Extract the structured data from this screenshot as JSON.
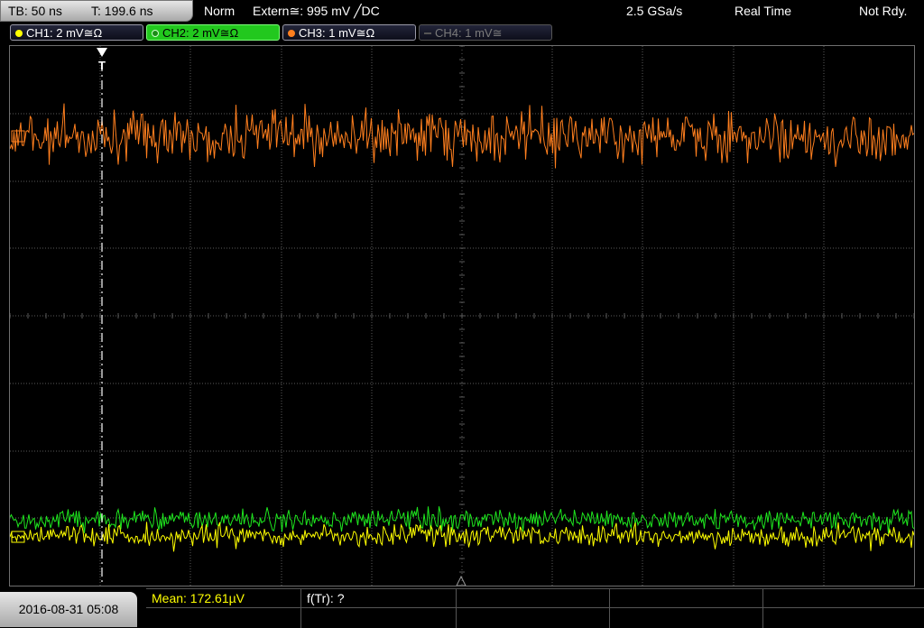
{
  "topbar": {
    "timebase": "TB: 50 ns",
    "trigger_time": "T: 199.6 ns",
    "mode": "Norm",
    "trigger_source": "Extern≅: 995 mV ╱DC",
    "sample_rate": "2.5 GSa/s",
    "acq_mode": "Real Time",
    "state": "Not Rdy."
  },
  "channels": [
    {
      "label": "CH1: 2 mV≅Ω",
      "color": "#ffff00"
    },
    {
      "label": "CH2: 2 mV≅Ω",
      "color": "#22c81e"
    },
    {
      "label": "CH3: 1 mV≅Ω",
      "color": "#ff7f1e"
    },
    {
      "label": "CH4: 1 mV≅",
      "color": "#7a7a7a"
    }
  ],
  "trigger_marker": "T",
  "colors": {
    "ch1": "#ffff00",
    "ch2": "#1ee61e",
    "ch3": "#ff7f1e",
    "grid": "#5a5a5a",
    "mean_text": "#ffff00"
  },
  "footer": {
    "datetime": "2016-08-31 05:08",
    "mean": "Mean: 172.61µV",
    "ftr": "f(Tr): ?"
  }
}
